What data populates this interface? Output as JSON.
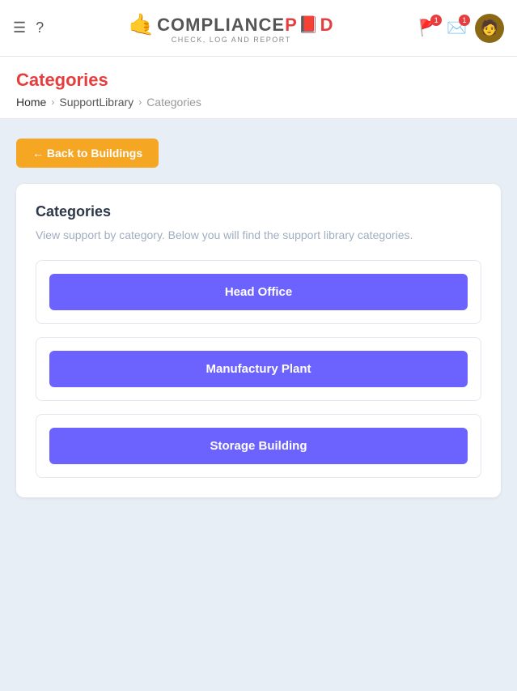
{
  "header": {
    "hamburger_icon": "☰",
    "question_icon": "?",
    "logo": {
      "hand": "🤙",
      "compliance": "COMPLIANCE",
      "p": "P",
      "book": "📕",
      "d": "D",
      "tagline": "CHECK, LOG AND REPORT"
    },
    "flag_badge": "1",
    "mail_badge": "1",
    "avatar_emoji": "👤"
  },
  "page_header": {
    "title": "Categories",
    "breadcrumbs": [
      {
        "label": "Home",
        "active": true
      },
      {
        "label": "SupportLibrary",
        "active": true
      },
      {
        "label": "Categories",
        "active": false
      }
    ]
  },
  "back_button": {
    "label": "← Back to Buildings"
  },
  "categories_section": {
    "title": "Categories",
    "description": "View support by category. Below you will find the support library categories.",
    "items": [
      {
        "label": "Head Office"
      },
      {
        "label": "Manufactury Plant"
      },
      {
        "label": "Storage Building"
      }
    ]
  }
}
